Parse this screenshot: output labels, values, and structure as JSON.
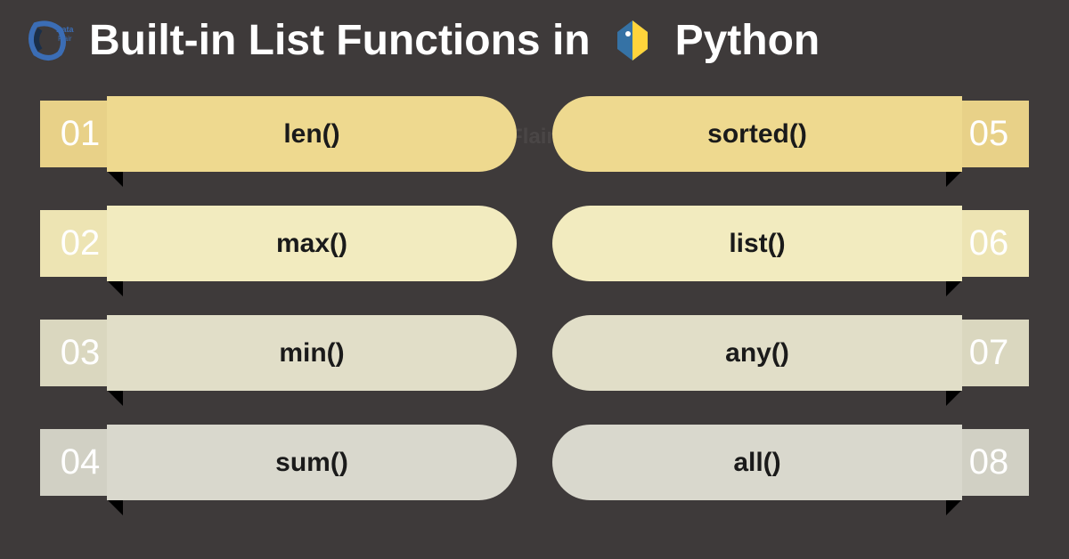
{
  "brand": "DataFlair",
  "title_part1": "Built-in List Functions in",
  "title_part2": "Python",
  "left_items": [
    {
      "num": "01",
      "label": "len()"
    },
    {
      "num": "02",
      "label": "max()"
    },
    {
      "num": "03",
      "label": "min()"
    },
    {
      "num": "04",
      "label": "sum()"
    }
  ],
  "right_items": [
    {
      "num": "05",
      "label": "sorted()"
    },
    {
      "num": "06",
      "label": "list()"
    },
    {
      "num": "07",
      "label": "any()"
    },
    {
      "num": "08",
      "label": "all()"
    }
  ]
}
